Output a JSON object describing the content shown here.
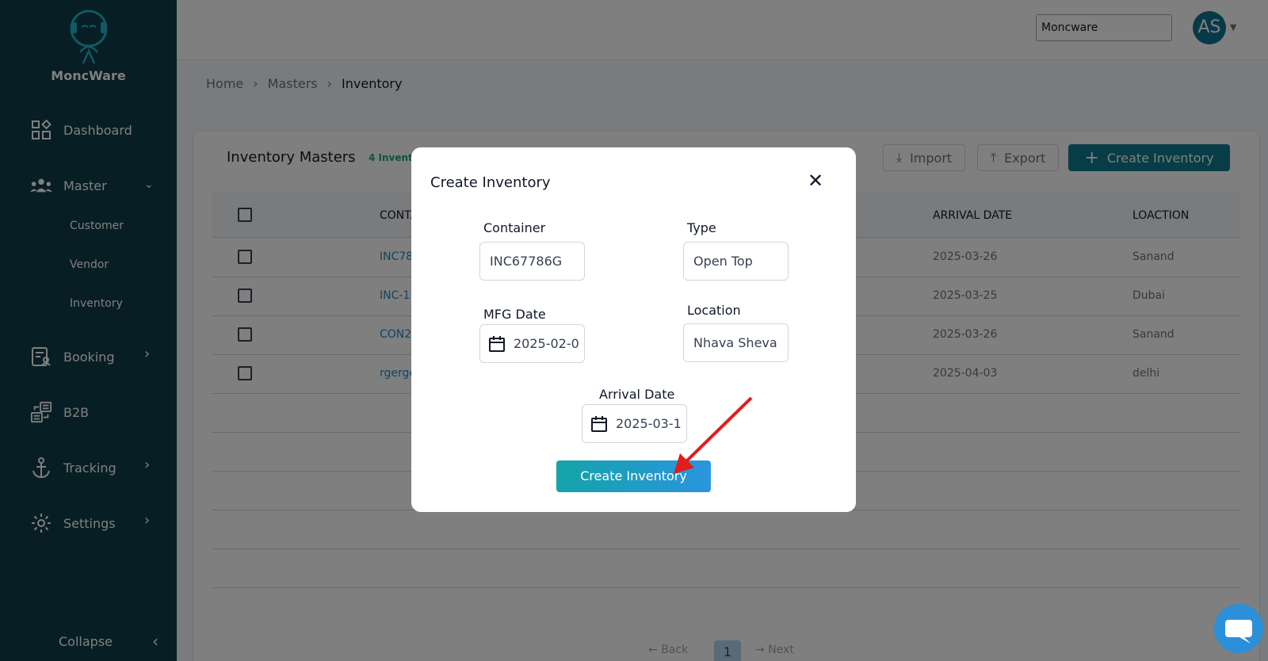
{
  "app": {
    "name": "MoncWare"
  },
  "sidebar": {
    "items": [
      {
        "label": "Dashboard"
      },
      {
        "label": "Master"
      },
      {
        "label": "Booking"
      },
      {
        "label": "B2B"
      },
      {
        "label": "Tracking"
      },
      {
        "label": "Settings"
      }
    ],
    "sub_items": [
      {
        "label": "Customer"
      },
      {
        "label": "Vendor"
      },
      {
        "label": "Inventory"
      }
    ],
    "collapse_label": "Collapse"
  },
  "header": {
    "org_value": "Moncware",
    "avatar_initials": "AS"
  },
  "breadcrumb": [
    "Home",
    "Masters",
    "Inventory"
  ],
  "page": {
    "title": "Inventory Masters",
    "count": "4 Invent",
    "import_label": "Import",
    "export_label": "Export",
    "create_label": "Create Inventory"
  },
  "table": {
    "columns": [
      "CONTA",
      "ARRIVAL DATE",
      "LOACTION"
    ],
    "rows": [
      {
        "container": "INC78",
        "arrival": "2025-03-26",
        "location": "Sanand"
      },
      {
        "container": "INC-1",
        "arrival": "2025-03-25",
        "location": "Dubai"
      },
      {
        "container": "CON2",
        "arrival": "2025-03-26",
        "location": "Sanand"
      },
      {
        "container": "rgerge",
        "arrival": "2025-04-03",
        "location": "delhi"
      }
    ]
  },
  "pagination": {
    "back": "Back",
    "page": "1",
    "next": "Next"
  },
  "modal": {
    "title": "Create Inventory",
    "fields": {
      "container": {
        "label": "Container",
        "value": "INC67786G"
      },
      "type": {
        "label": "Type",
        "value": "Open Top"
      },
      "mfg_date": {
        "label": "MFG Date",
        "value": "2025-02-0"
      },
      "location": {
        "label": "Location",
        "value": "Nhava Sheva"
      },
      "arrival_date": {
        "label": "Arrival Date",
        "value": "2025-03-1"
      }
    },
    "submit_label": "Create Inventory"
  },
  "colors": {
    "sidebar": "#0f3d48",
    "primary": "#0f7a8c",
    "link": "#1e88c8",
    "annotation_arrow": "#e11d1d"
  }
}
